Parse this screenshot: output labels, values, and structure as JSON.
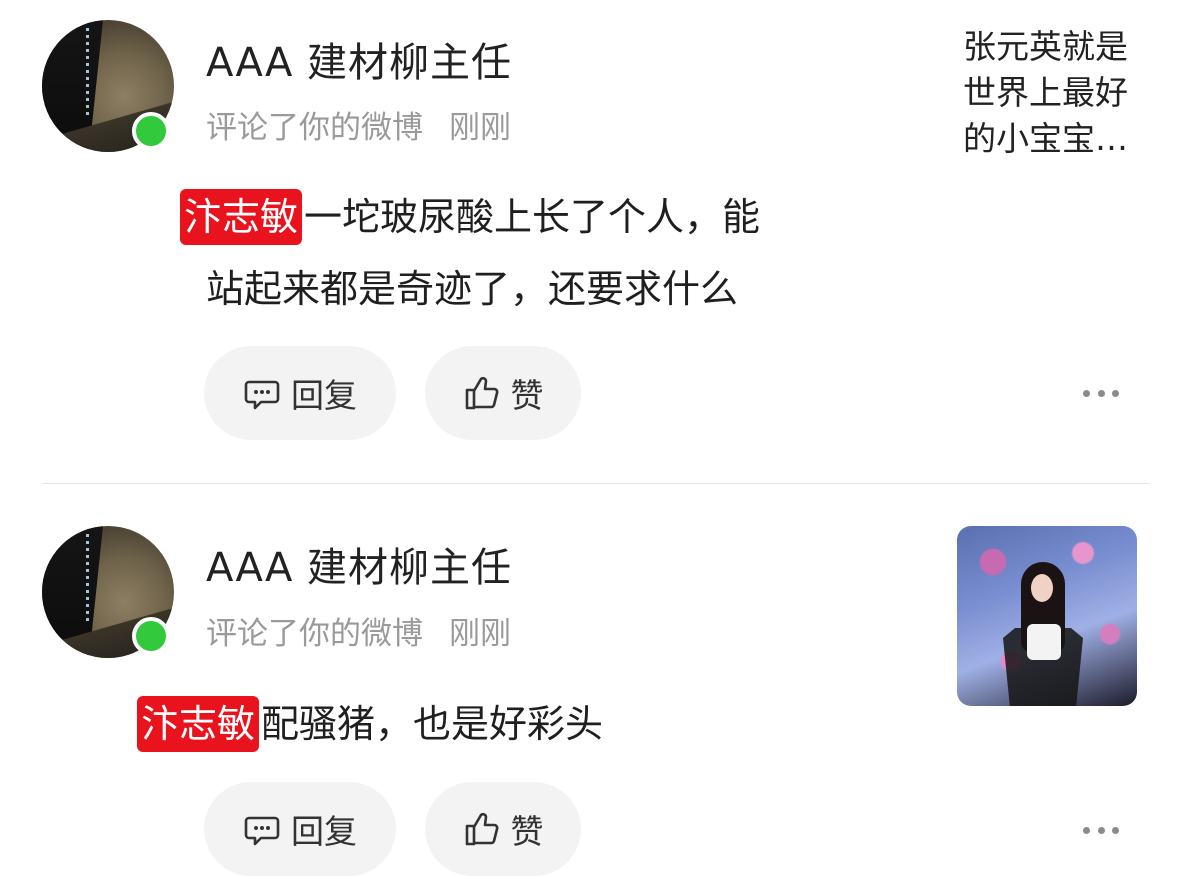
{
  "notifications": [
    {
      "username": "AAA 建材柳主任",
      "action": "评论了你的微博",
      "time": "刚刚",
      "mention": "汴志敏",
      "comment_line1": "一坨玻尿酸上长了个人，能",
      "comment_line2": "站起来都是奇迹了，还要求什么",
      "reply_label": "回复",
      "like_label": "赞",
      "original_post": "张元英就是\n世界上最好\n的小宝宝…"
    },
    {
      "username": "AAA 建材柳主任",
      "action": "评论了你的微博",
      "time": "刚刚",
      "mention": "汴志敏",
      "comment_text": "配骚猪，也是好彩头",
      "reply_label": "回复",
      "like_label": "赞"
    }
  ],
  "colors": {
    "mention_bg": "#e8131c",
    "online": "#33c93d",
    "meta_text": "#9a9a9a",
    "pill_bg": "#f3f3f3"
  },
  "icons": [
    "comment-bubble-icon",
    "thumbs-up-icon",
    "more-dots-icon"
  ]
}
